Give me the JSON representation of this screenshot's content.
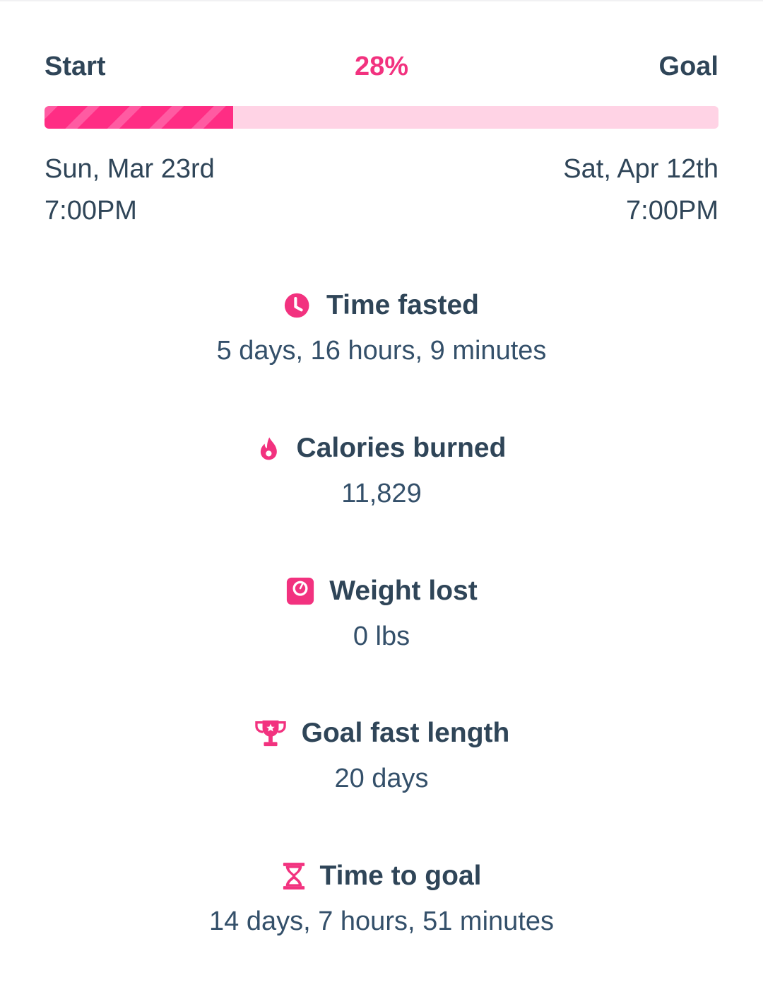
{
  "progress": {
    "start_label": "Start",
    "goal_label": "Goal",
    "percent_label": "28%",
    "percent_value": 28,
    "start_date": "Sun, Mar 23rd",
    "start_time": "7:00PM",
    "goal_date": "Sat, Apr 12th",
    "goal_time": "7:00PM",
    "track_color": "#ffd3e5",
    "fill_color": "#ff2d84"
  },
  "stats": [
    {
      "icon": "clock-icon",
      "title": "Time fasted",
      "value": "5 days, 16 hours, 9 minutes"
    },
    {
      "icon": "flame-icon",
      "title": "Calories burned",
      "value": "11,829"
    },
    {
      "icon": "scale-icon",
      "title": "Weight lost",
      "value": "0 lbs"
    },
    {
      "icon": "trophy-icon",
      "title": "Goal fast length",
      "value": "20 days"
    },
    {
      "icon": "hourglass-icon",
      "title": "Time to goal",
      "value": "14 days, 7 hours, 51 minutes"
    }
  ],
  "colors": {
    "accent": "#f2327f",
    "text": "#2f4558"
  }
}
